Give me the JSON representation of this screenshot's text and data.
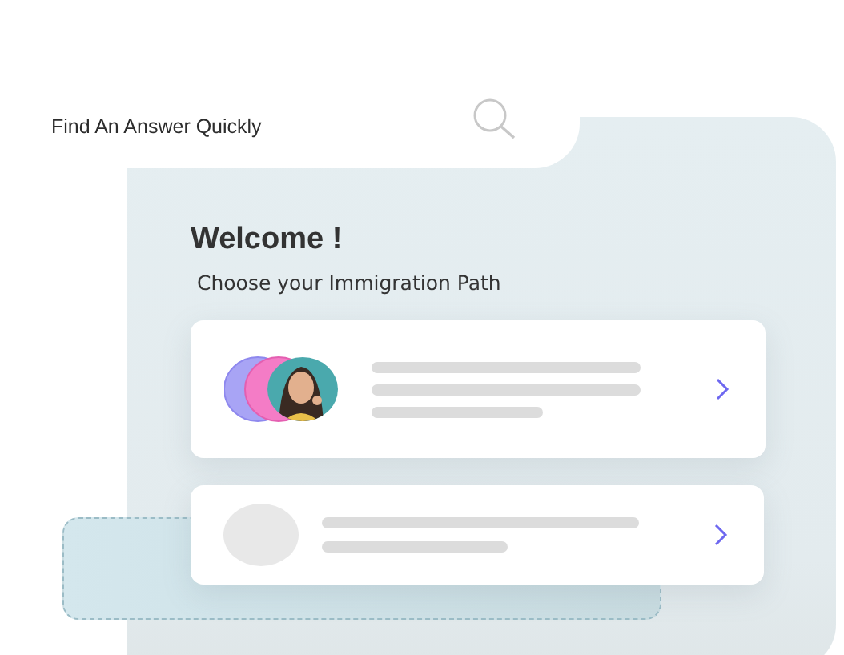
{
  "search": {
    "placeholder": "Find An Answer Quickly"
  },
  "title": "Welcome !",
  "subtitle": "Choose your Immigration Path",
  "paths": [
    {
      "kind": "avatars"
    },
    {
      "kind": "blank"
    }
  ]
}
